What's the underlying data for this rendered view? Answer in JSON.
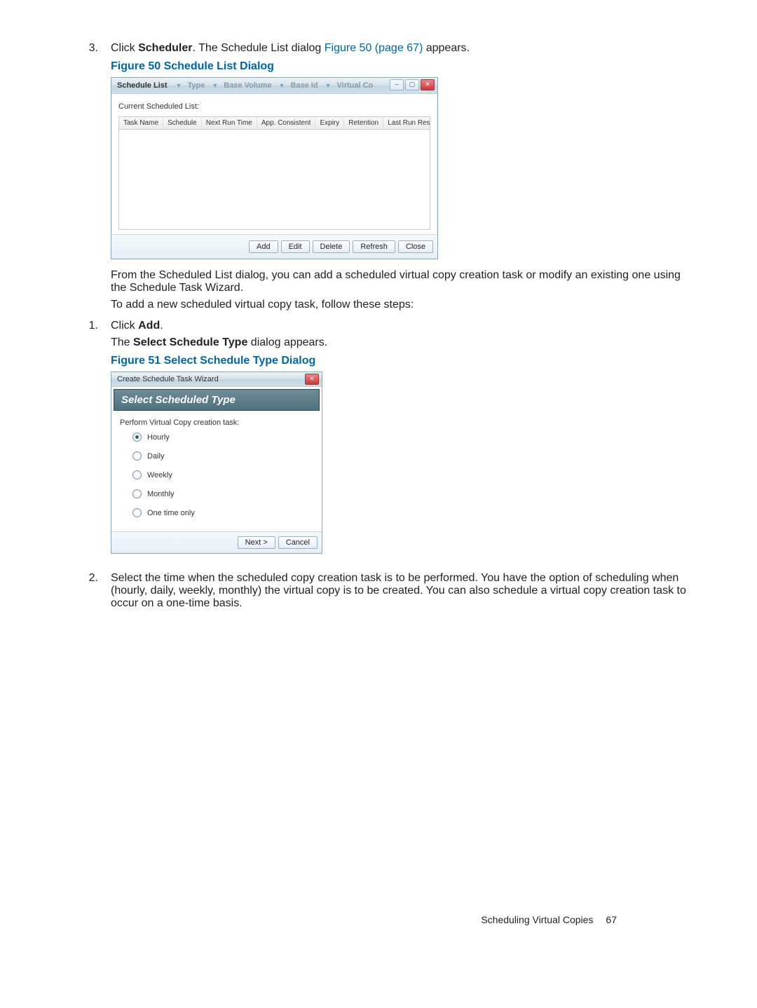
{
  "step3": {
    "num": "3.",
    "pre": "Click ",
    "bold": "Scheduler",
    "mid": ". The Schedule List dialog ",
    "link": "Figure 50 (page 67)",
    "post": " appears."
  },
  "fig50": {
    "caption": "Figure 50 Schedule List Dialog",
    "title": "Schedule List",
    "ghost": [
      "Type",
      "Base Volume",
      "Base Id",
      "Virtual Co"
    ],
    "section": "Current Scheduled List:",
    "cols": [
      "Task Name",
      "Schedule",
      "Next Run Time",
      "App. Consistent",
      "Expiry",
      "Retention",
      "Last Run Result"
    ],
    "buttons": [
      "Add",
      "Edit",
      "Delete",
      "Refresh",
      "Close"
    ],
    "p1": "From the Scheduled List dialog, you can add a scheduled virtual copy creation task or modify an existing one using the Schedule Task Wizard.",
    "p2": "To add a new scheduled virtual copy task, follow these steps:"
  },
  "step1": {
    "num": "1.",
    "pre": "Click ",
    "bold": "Add",
    "post": ".",
    "line2a": "The ",
    "line2b": "Select Schedule Type",
    "line2c": " dialog appears."
  },
  "fig51": {
    "caption": "Figure 51 Select Schedule Type Dialog",
    "title": "Create Schedule Task Wizard",
    "banner": "Select Scheduled Type",
    "prompt": "Perform Virtual Copy creation task:",
    "options": [
      "Hourly",
      "Daily",
      "Weekly",
      "Monthly",
      "One time only"
    ],
    "selected": 0,
    "buttons": [
      "Next >",
      "Cancel"
    ]
  },
  "step2": {
    "num": "2.",
    "text": "Select the time when the scheduled copy creation task is to be performed. You have the option of scheduling when (hourly, daily, weekly, monthly) the virtual copy is to be created. You can also schedule a virtual copy creation task to occur on a one-time basis."
  },
  "footer": {
    "section": "Scheduling Virtual Copies",
    "page": "67"
  }
}
